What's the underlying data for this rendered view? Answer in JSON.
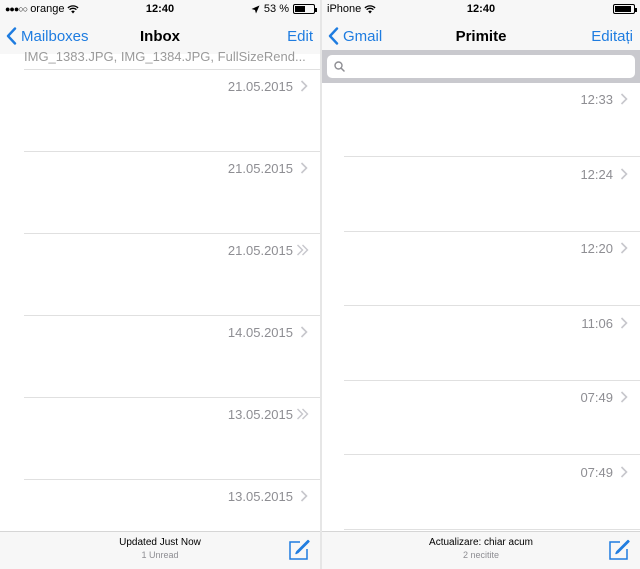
{
  "accent_color": "#1e7ce0",
  "left": {
    "status": {
      "carrier": "orange",
      "time": "12:40",
      "battery": "53 %",
      "battery_level": 0.53
    },
    "nav": {
      "back_label": "Mailboxes",
      "title": "Inbox",
      "edit_label": "Edit"
    },
    "peek_text": "IMG_1383.JPG, IMG_1384.JPG, FullSizeRend...",
    "rows": [
      {
        "date": "21.05.2015",
        "icon": "chevron-right-icon"
      },
      {
        "date": "21.05.2015",
        "icon": "chevron-right-icon"
      },
      {
        "date": "21.05.2015",
        "icon": "double-chevron-right-icon"
      },
      {
        "date": "14.05.2015",
        "icon": "chevron-right-icon"
      },
      {
        "date": "13.05.2015",
        "icon": "double-chevron-right-icon"
      },
      {
        "date": "13.05.2015",
        "icon": "chevron-right-icon"
      }
    ],
    "toolbar": {
      "status": "Updated Just Now",
      "unread": "1 Unread"
    }
  },
  "right": {
    "status": {
      "carrier": "iPhone",
      "time": "12:40",
      "battery_level": 0.9
    },
    "nav": {
      "back_label": "Gmail",
      "title": "Primite",
      "edit_label": "Editați"
    },
    "search": {
      "placeholder": ""
    },
    "rows": [
      {
        "time": "12:33"
      },
      {
        "time": "12:24"
      },
      {
        "time": "12:20"
      },
      {
        "time": "11:06"
      },
      {
        "time": "07:49"
      },
      {
        "time": "07:49"
      }
    ],
    "toolbar": {
      "status": "Actualizare: chiar acum",
      "unread": "2 necitite"
    }
  }
}
